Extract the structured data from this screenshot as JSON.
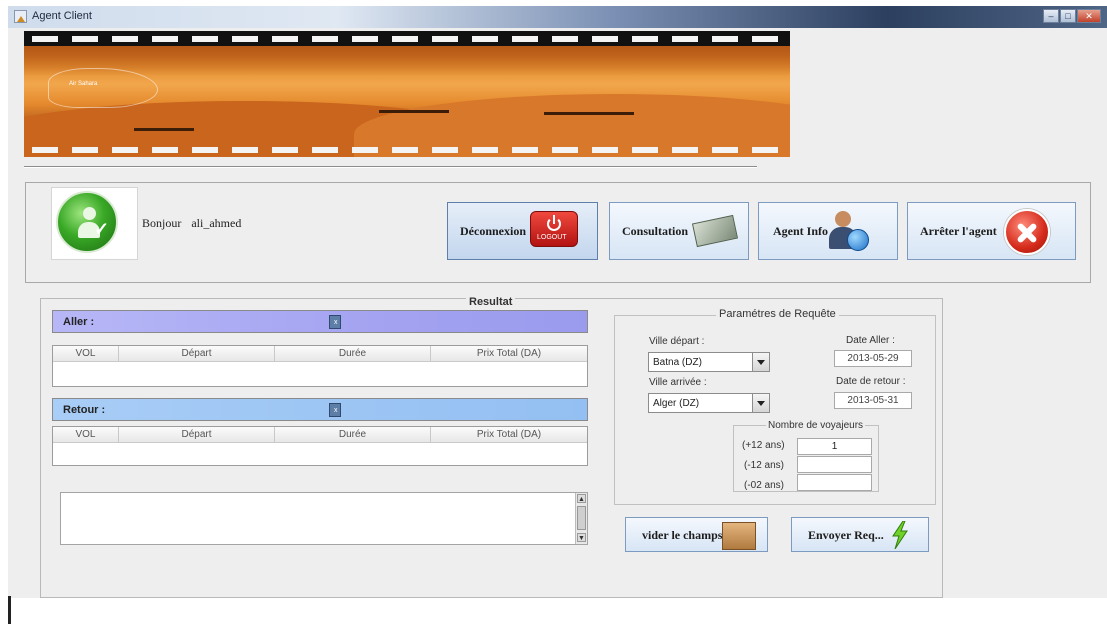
{
  "window": {
    "title": "Agent Client",
    "controls": [
      "minimize",
      "maximize",
      "close"
    ]
  },
  "banner": {
    "logo_text": "Air Sahara"
  },
  "user": {
    "greeting": "Bonjour",
    "username": "ali_ahmed"
  },
  "actions": {
    "logout_label": "Déconnexion",
    "logout_icon_text": "LOGOUT",
    "consultation_label": "Consultation",
    "agent_info_label": "Agent Info",
    "stop_agent_label": "Arrêter l'agent"
  },
  "results": {
    "title": "Resultat",
    "outbound_label": "Aller :",
    "return_label": "Retour :",
    "columns": [
      "VOL",
      "Départ",
      "Durée",
      "Prix Total (DA)"
    ]
  },
  "params": {
    "title": "Paramétres de Requête",
    "departure_city_label": "Ville départ :",
    "departure_city_value": "Batna (DZ)",
    "arrival_city_label": "Ville arrivée :",
    "arrival_city_value": "Alger (DZ)",
    "outbound_date_label": "Date Aller :",
    "outbound_date_value": "2013-05-29",
    "return_date_label": "Date de retour :",
    "return_date_value": "2013-05-31",
    "travellers_title": "Nombre de voyajeurs",
    "adults_label": "(+12 ans)",
    "adults_value": "1",
    "children_label": "(-12 ans)",
    "children_value": "",
    "infants_label": "(-02 ans)",
    "infants_value": ""
  },
  "bottom_buttons": {
    "clear_label": "vider le champs",
    "send_label": "Envoyer Req..."
  },
  "colors": {
    "outbound_bar": "#a3a3f1",
    "return_bar": "#93bff2",
    "button_gradient_top": "#f4f8fd",
    "button_gradient_bottom": "#d7e5f5",
    "stop_red": "#d42a1a",
    "avatar_green": "#39a826"
  }
}
